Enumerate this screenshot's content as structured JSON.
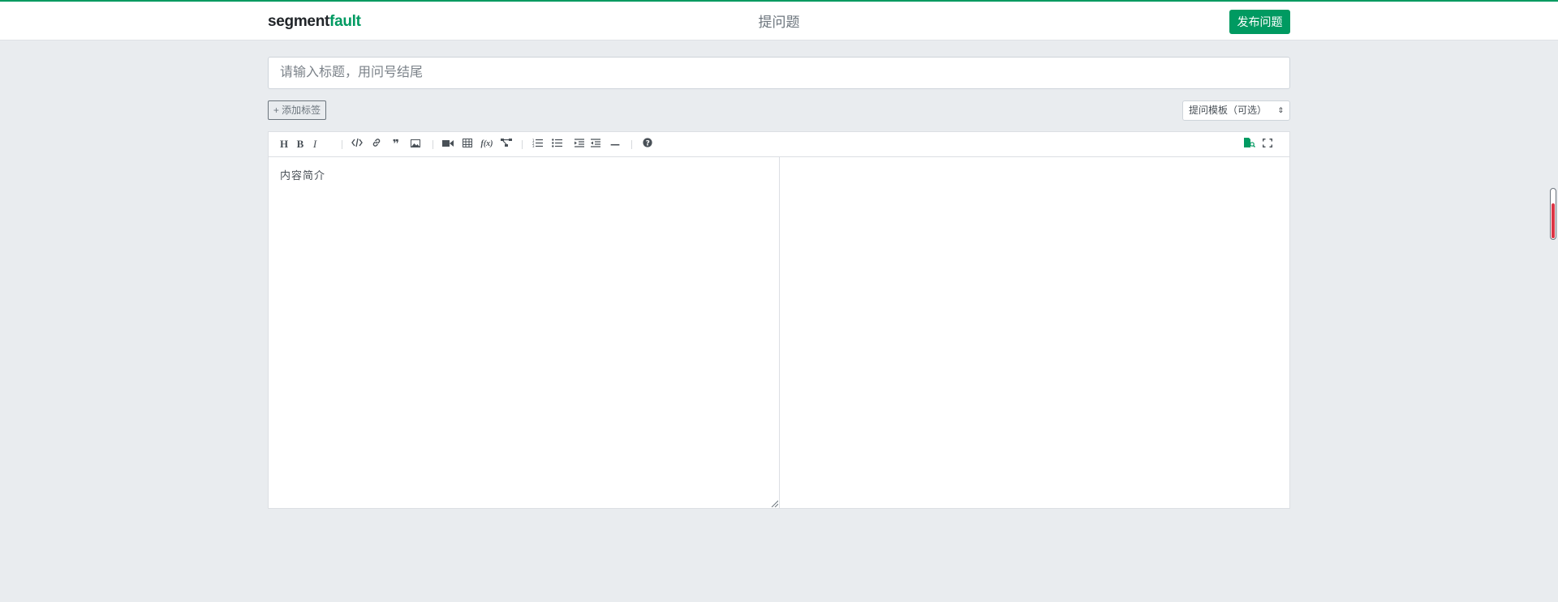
{
  "header": {
    "logo_part1": "segment",
    "logo_part2": "fault",
    "page_title": "提问题",
    "publish_label": "发布问题"
  },
  "form": {
    "title_placeholder": "请输入标题，用问号结尾",
    "add_tag_label": "+ 添加标签",
    "template_select_value": "提问模板（可选）"
  },
  "editor": {
    "content_placeholder": "内容简介",
    "toolbar": [
      {
        "name": "heading-icon",
        "glyph": "H"
      },
      {
        "name": "bold-icon",
        "glyph": "B"
      },
      {
        "name": "italic-icon",
        "glyph": "I"
      },
      {
        "name": "code-icon",
        "glyph": "</>"
      },
      {
        "name": "link-icon",
        "glyph": "🔗"
      },
      {
        "name": "quote-icon",
        "glyph": "❞"
      },
      {
        "name": "image-icon",
        "glyph": "▣"
      },
      {
        "name": "video-icon",
        "glyph": "■"
      },
      {
        "name": "table-icon",
        "glyph": "⊞"
      },
      {
        "name": "formula-icon",
        "glyph": "f(x)"
      },
      {
        "name": "flowchart-icon",
        "glyph": "⋈"
      },
      {
        "name": "ordered-list-icon",
        "glyph": "≡"
      },
      {
        "name": "unordered-list-icon",
        "glyph": "☰"
      },
      {
        "name": "indent-icon",
        "glyph": "⇥"
      },
      {
        "name": "outdent-icon",
        "glyph": "⇤"
      },
      {
        "name": "horizontal-rule-icon",
        "glyph": "—"
      },
      {
        "name": "help-icon",
        "glyph": "?"
      }
    ]
  },
  "colors": {
    "brand": "#009a61",
    "background": "#e9ecef",
    "scroll_fill": "#dc3545"
  }
}
